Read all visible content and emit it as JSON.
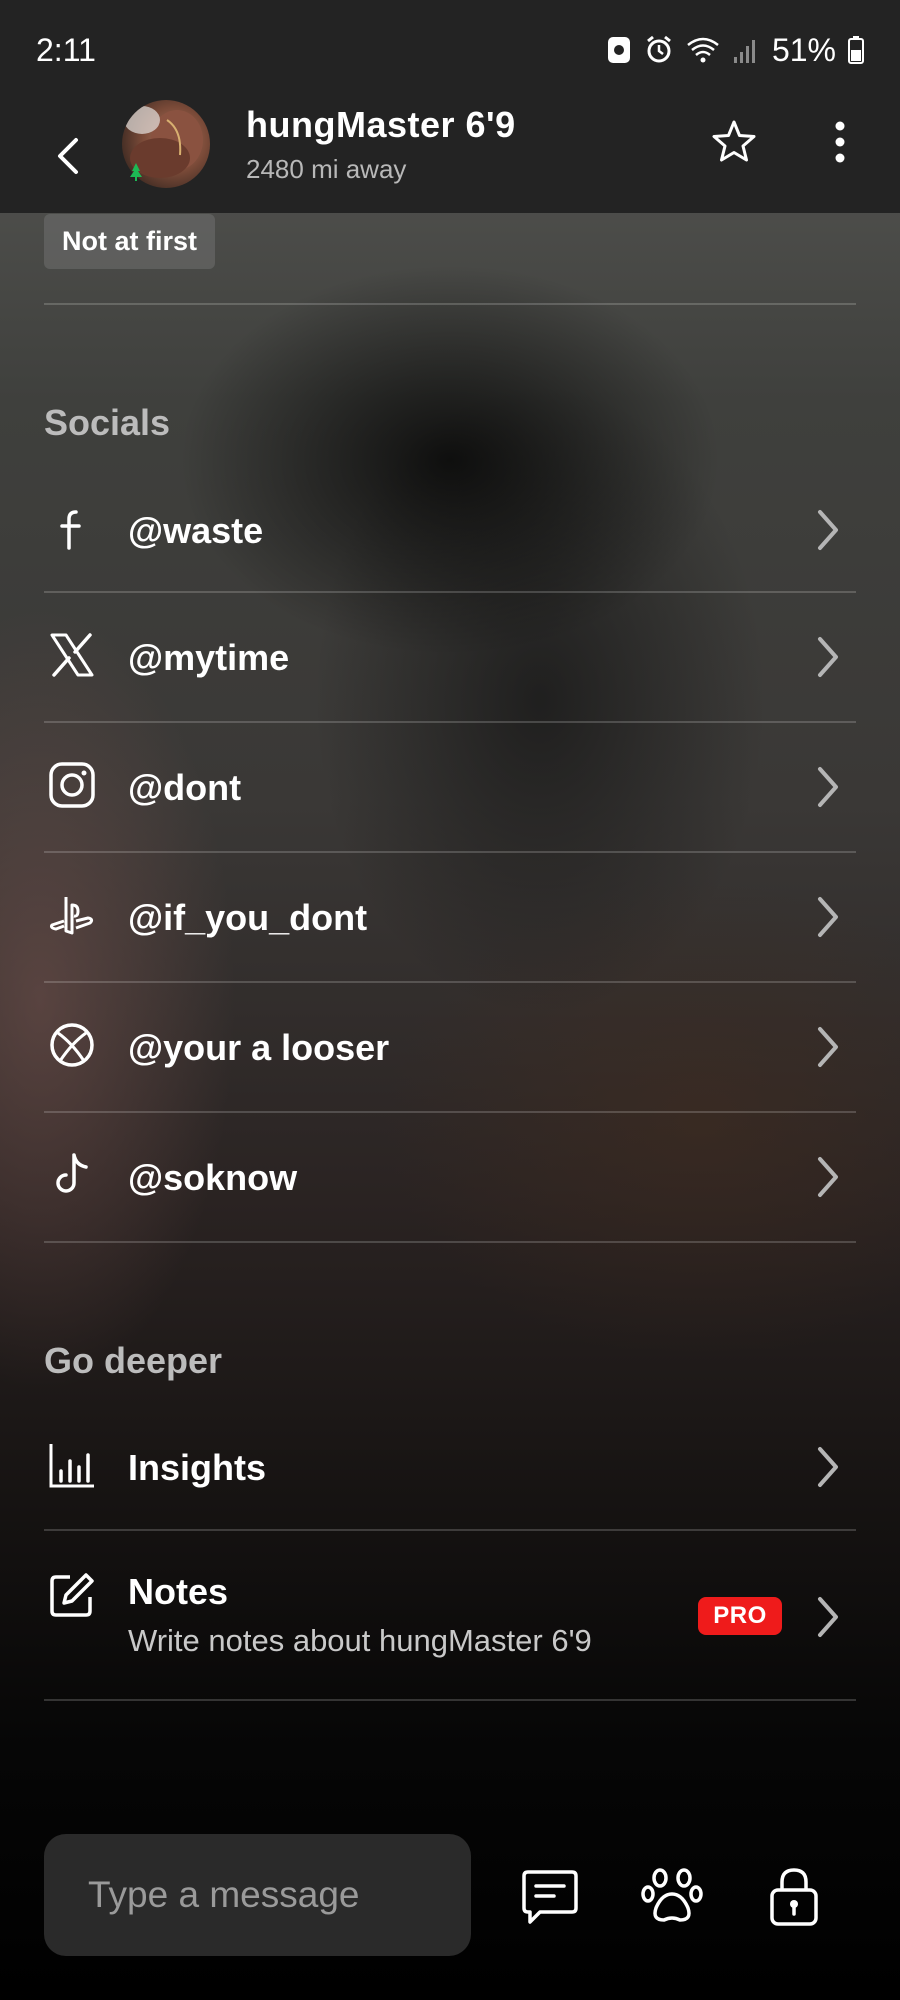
{
  "status_bar": {
    "time": "2:11",
    "battery": "51%"
  },
  "header": {
    "name": "hungMaster 6'9",
    "distance": "2480 mi away"
  },
  "tag": {
    "label": "Not at first"
  },
  "socials": {
    "title": "Socials",
    "items": [
      {
        "icon": "facebook-icon",
        "handle": "@waste"
      },
      {
        "icon": "x-icon",
        "handle": "@mytime"
      },
      {
        "icon": "instagram-icon",
        "handle": "@dont"
      },
      {
        "icon": "playstation-icon",
        "handle": "@if_you_dont"
      },
      {
        "icon": "xbox-icon",
        "handle": "@your a looser"
      },
      {
        "icon": "tiktok-icon",
        "handle": "@soknow"
      }
    ]
  },
  "go_deeper": {
    "title": "Go deeper",
    "insights": {
      "label": "Insights"
    },
    "notes": {
      "label": "Notes",
      "subtitle": "Write notes about hungMaster 6'9",
      "badge": "PRO"
    }
  },
  "message_bar": {
    "placeholder": "Type a message"
  },
  "colors": {
    "accent_red": "#ef1b1b",
    "online_green": "#1db954",
    "header_bg": "#232323"
  }
}
